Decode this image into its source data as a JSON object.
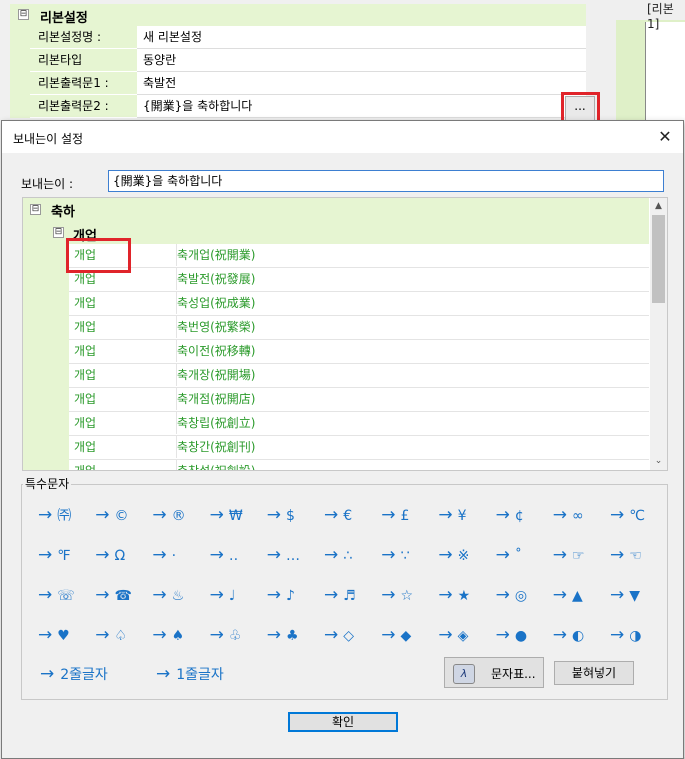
{
  "background": {
    "group_title": "리본설정",
    "group_toggle": "⊟",
    "rows": [
      {
        "label": "리본설정명 :",
        "value": "새 리본설정"
      },
      {
        "label": "리본타입",
        "value": "동양란"
      },
      {
        "label": "리본출력문1 :",
        "value": "축발전"
      },
      {
        "label": "리본출력문2 :",
        "value": "{開業}을 축하합니다"
      }
    ],
    "ellipsis_label": "...",
    "right_panel_label": "[리본1]"
  },
  "dialog": {
    "title": "보내는이 설정",
    "close_symbol": "✕",
    "sender_label": "보내는이 :",
    "sender_value": "{開業}을 축하합니다",
    "tree": {
      "group1": {
        "toggle": "⊟",
        "label": "축하"
      },
      "group2": {
        "toggle": "⊟",
        "label": "개업"
      },
      "items": [
        {
          "cat": "개업",
          "text": "축개업(祝開業)"
        },
        {
          "cat": "개업",
          "text": "축발전(祝發展)"
        },
        {
          "cat": "개업",
          "text": "축성업(祝成業)"
        },
        {
          "cat": "개업",
          "text": "축번영(祝繁榮)"
        },
        {
          "cat": "개업",
          "text": "축이전(祝移轉)"
        },
        {
          "cat": "개업",
          "text": "축개장(祝開場)"
        },
        {
          "cat": "개업",
          "text": "축개점(祝開店)"
        },
        {
          "cat": "개업",
          "text": "축창립(祝創立)"
        },
        {
          "cat": "개업",
          "text": "축창간(祝創刊)"
        },
        {
          "cat": "개업",
          "text": "축창설(祝創設)"
        }
      ],
      "scroll_up": "▲",
      "scroll_down": "⌄"
    },
    "special": {
      "legend": "특수문자",
      "arrow": "→",
      "symbols": [
        "㈜",
        "©",
        "®",
        "₩",
        "$",
        "€",
        "£",
        "¥",
        "¢",
        "∞",
        "℃",
        "℉",
        "Ω",
        "·",
        "‥",
        "…",
        "∴",
        "∵",
        "※",
        "˚",
        "☞",
        "☜",
        "☏",
        "☎",
        "♨",
        "♩",
        "♪",
        "♬",
        "☆",
        "★",
        "◎",
        "▲",
        "▼",
        "♥",
        "♤",
        "♠",
        "♧",
        "♣",
        "◇",
        "◆",
        "◈",
        "●",
        "◐",
        "◑"
      ],
      "two_line": "2줄글자",
      "one_line": "1줄글자",
      "charmap_label": "문자표...",
      "charmap_icon": "λ",
      "paste_label": "붙혀넣기"
    },
    "ok_label": "확인"
  },
  "colors": {
    "group_bg": "#e6f5d2",
    "item_text": "#2a9a2a",
    "symbol_text": "#1a73c7",
    "highlight": "#e0242a",
    "input_border": "#3d7fd1"
  }
}
